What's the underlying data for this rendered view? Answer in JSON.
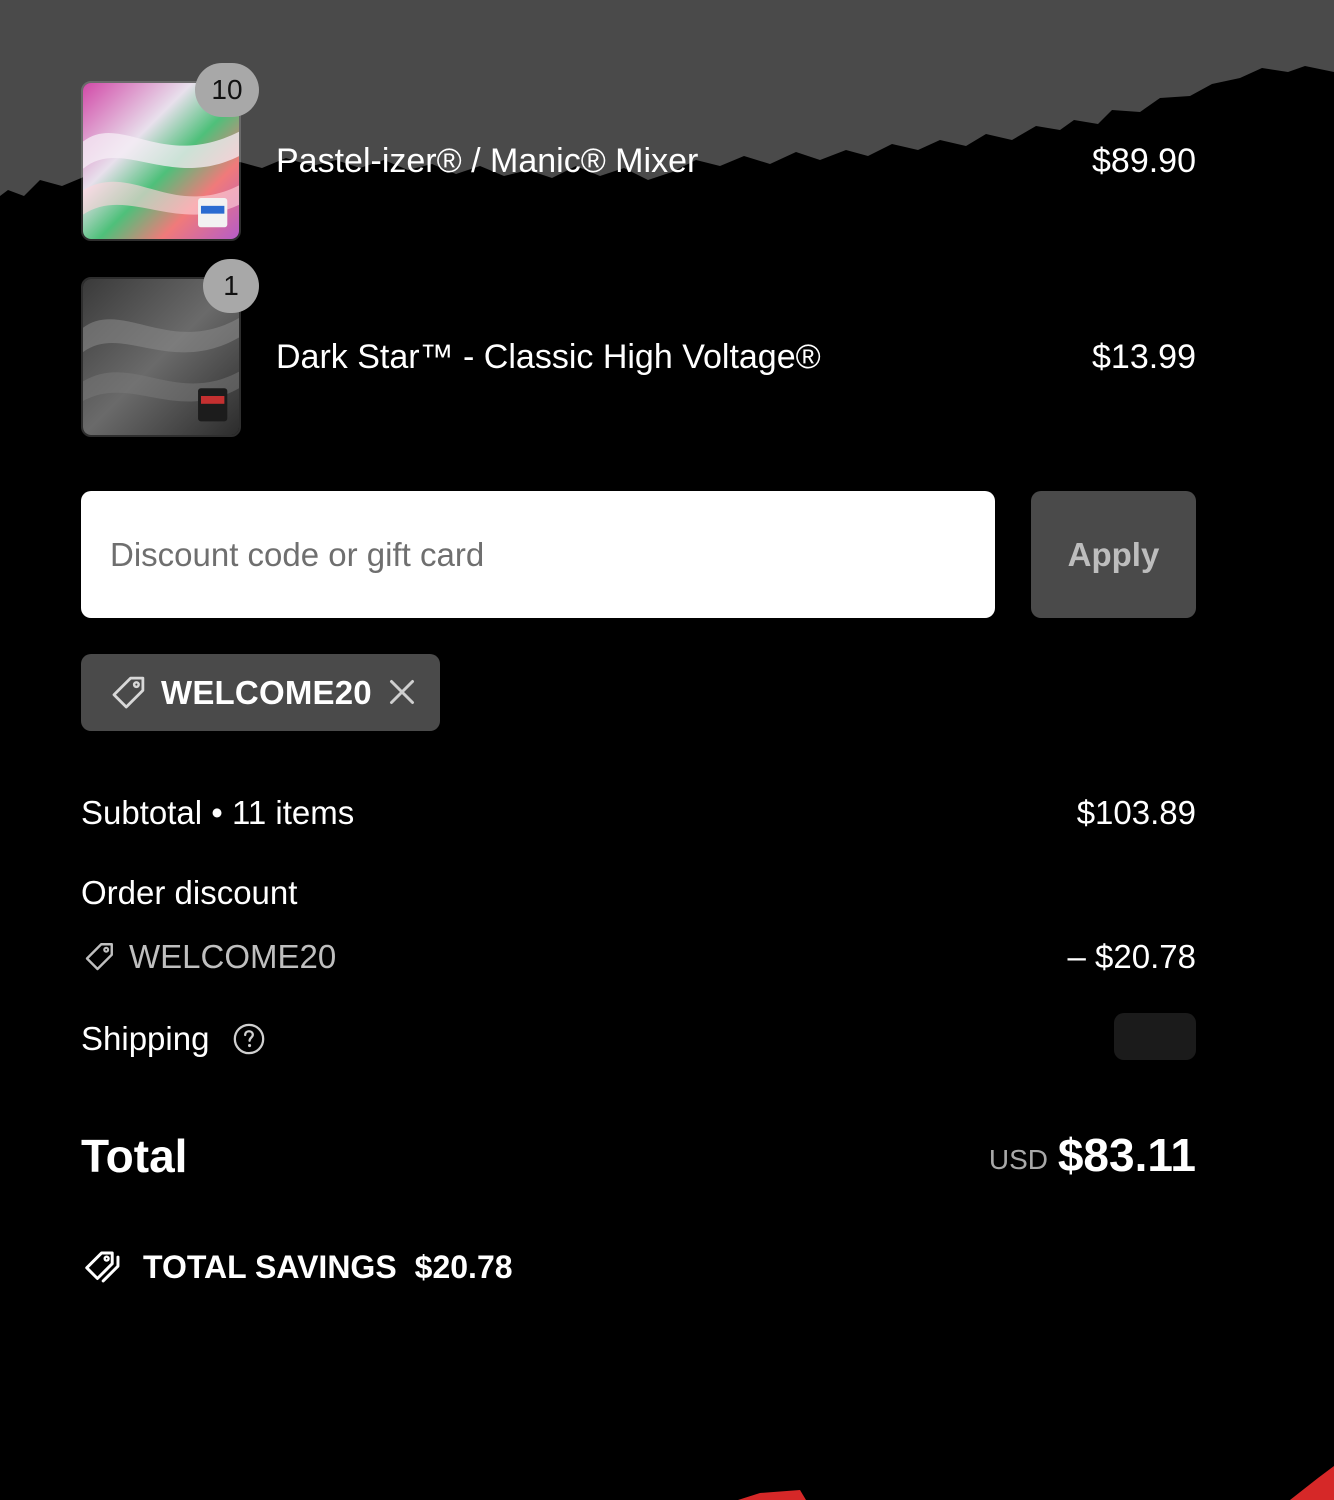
{
  "line_items": [
    {
      "name": "Pastel-izer® / Manic® Mixer",
      "quantity": "10",
      "price": "$89.90",
      "thumbnail_icon": "pastel-swirl-product-image"
    },
    {
      "name": "Dark Star™ - Classic High Voltage®",
      "quantity": "1",
      "price": "$13.99",
      "thumbnail_icon": "dark-gray-swirl-product-image"
    }
  ],
  "discount": {
    "placeholder": "Discount code or gift card",
    "value": "",
    "apply_label": "Apply",
    "applied_code": "WELCOME20",
    "tag_icon": "tag-icon",
    "remove_icon": "close-icon"
  },
  "summary": {
    "subtotal_label": "Subtotal • 11 items",
    "subtotal_value": "$103.89",
    "order_discount_label": "Order discount",
    "discount_code": "WELCOME20",
    "discount_value": "– $20.78",
    "shipping_label": "Shipping",
    "shipping_help_icon": "question-circle-icon",
    "total_label": "Total",
    "total_currency": "USD",
    "total_value": "$83.11",
    "savings_label": "TOTAL SAVINGS",
    "savings_value": "$20.78",
    "savings_icon": "double-tag-icon"
  },
  "colors": {
    "page_background": "#000000",
    "torn_header": "#4a4a4a",
    "chip_background": "#4a4a4a",
    "badge_background": "#a8a8a8",
    "accent_red": "#d62828"
  }
}
